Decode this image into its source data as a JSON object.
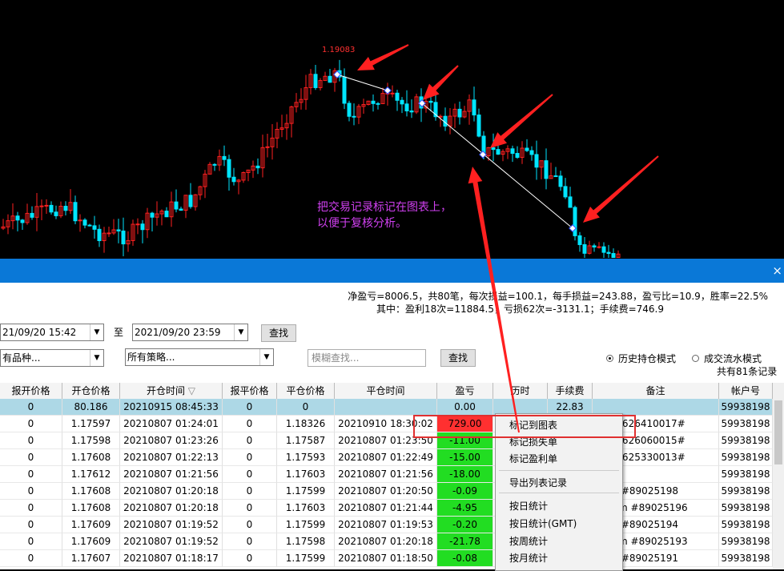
{
  "chart": {
    "price_label": "1.19083",
    "annotation_line1": "把交易记录标记在图表上，",
    "annotation_line2": "以便于复核分析。",
    "colors": {
      "up": "#ff2020",
      "down": "#00e5ff",
      "background": "#000000",
      "arrow": "#ff2020",
      "annotation": "#d040f0"
    }
  },
  "window": {
    "close_label": "×"
  },
  "stats": {
    "line1": "净盈亏=8006.5，共80笔，每次损益=100.1，每手损益=243.88，盈亏比=10.9，胜率=22.5%",
    "line2": "其中：盈利18次=11884.5，亏损62次=-3131.1；手续费=746.9"
  },
  "filters": {
    "start_time": "21/09/20 15:42",
    "to_label": "至",
    "end_time": "2021/09/20 23:59",
    "search_label": "查找",
    "symbol_select": "有品种...",
    "strategy_select": "所有策略...",
    "fuzzy_placeholder": "模糊查找...",
    "search2_label": "查找",
    "mode_history": "历史持仓模式",
    "mode_flow": "成交流水模式",
    "record_count": "共有81条记录"
  },
  "table": {
    "headers": [
      "报开价格",
      "开仓价格",
      "开仓时间",
      "报平价格",
      "平仓价格",
      "平仓时间",
      "盈亏",
      "历时",
      "手续费",
      "备注",
      "帐户号"
    ],
    "sort_indicator": "▽",
    "rows": [
      [
        "0",
        "80.186",
        "20210915 08:45:33",
        "0",
        "0",
        "",
        "0.00",
        "",
        "22.83",
        "",
        "59938198"
      ],
      [
        "0",
        "1.17597",
        "20210807 01:24:01",
        "0",
        "1.18326",
        "20210910 18:30:02",
        "729.00",
        "",
        "",
        "r@626410017#",
        "59938198"
      ],
      [
        "0",
        "1.17598",
        "20210807 01:23:26",
        "0",
        "1.17587",
        "20210807 01:23:50",
        "-11.00",
        "",
        "",
        "r@626060015#",
        "59938198"
      ],
      [
        "0",
        "1.17608",
        "20210807 01:22:13",
        "0",
        "1.17593",
        "20210807 01:22:49",
        "-15.00",
        "",
        "",
        "r@625330013#",
        "59938198"
      ],
      [
        "0",
        "1.17612",
        "20210807 01:21:56",
        "0",
        "1.17603",
        "20210807 01:21:56",
        "-18.00",
        "",
        "",
        "",
        "59938198"
      ],
      [
        "0",
        "1.17608",
        "20210807 01:20:18",
        "0",
        "1.17599",
        "20210807 01:20:50",
        "-0.09",
        "",
        "",
        "to #89025198",
        "59938198"
      ],
      [
        "0",
        "1.17608",
        "20210807 01:20:18",
        "0",
        "1.17603",
        "20210807 01:21:44",
        "-4.95",
        "",
        "",
        "rom #89025196",
        "59938198"
      ],
      [
        "0",
        "1.17609",
        "20210807 01:19:52",
        "0",
        "1.17599",
        "20210807 01:19:53",
        "-0.20",
        "",
        "",
        "to #89025194",
        "59938198"
      ],
      [
        "0",
        "1.17609",
        "20210807 01:19:52",
        "0",
        "1.17598",
        "20210807 01:20:18",
        "-21.78",
        "",
        "",
        "rom #89025193",
        "59938198"
      ],
      [
        "0",
        "1.17607",
        "20210807 01:18:17",
        "0",
        "1.17599",
        "20210807 01:18:50",
        "-0.08",
        "",
        "",
        "to #89025191",
        "59938198"
      ]
    ]
  },
  "context_menu": {
    "items": [
      "标记到图表",
      "标记损失单",
      "标记盈利单",
      "导出列表记录",
      "按日统计",
      "按日统计(GMT)",
      "按周统计",
      "按月统计"
    ]
  }
}
